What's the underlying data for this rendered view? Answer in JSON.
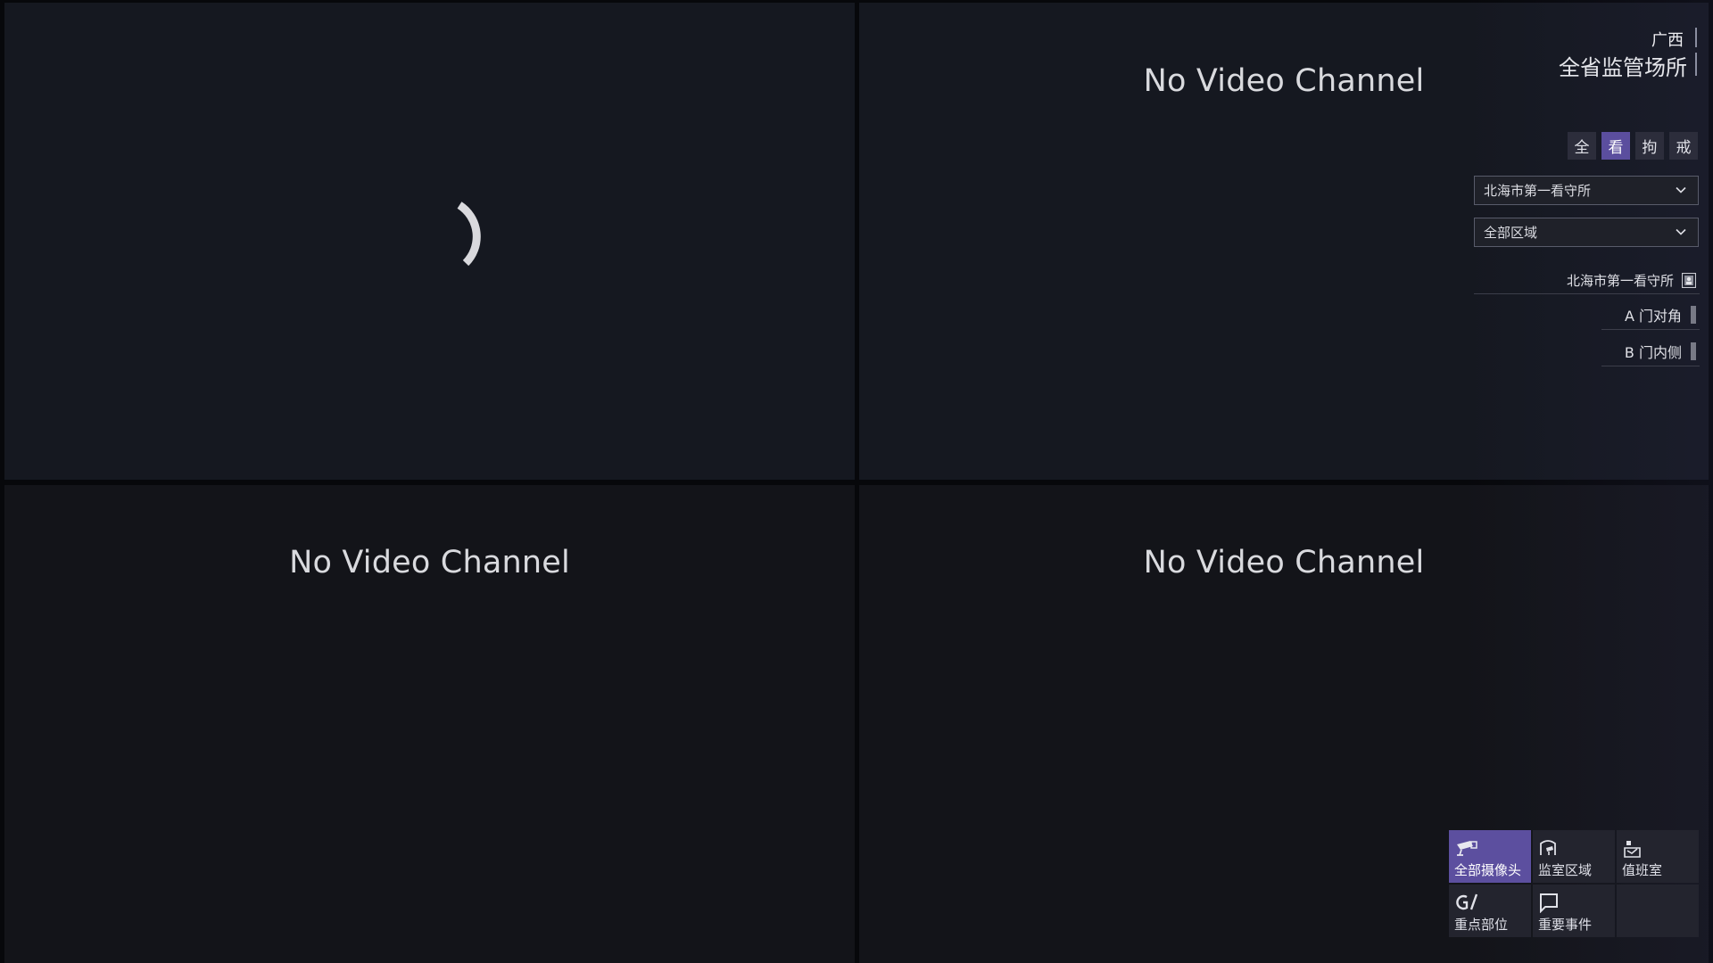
{
  "video_grid": {
    "cells": [
      {
        "status": "loading"
      },
      {
        "message": "No Video Channel"
      },
      {
        "message": "No Video Channel"
      },
      {
        "message": "No Video Channel"
      }
    ]
  },
  "header": {
    "province": "广西",
    "subtitle": "全省监管场所"
  },
  "facility_filters": [
    {
      "label": "全",
      "active": false
    },
    {
      "label": "看",
      "active": true
    },
    {
      "label": "拘",
      "active": false
    },
    {
      "label": "戒",
      "active": false
    }
  ],
  "facility_select": {
    "value": "北海市第一看守所"
  },
  "area_select": {
    "value": "全部区域"
  },
  "tree": {
    "root_label": "北海市第一看守所",
    "items": [
      {
        "label": "A 门对角"
      },
      {
        "label": "B 门内侧"
      }
    ]
  },
  "bottom_nav": [
    {
      "label": "全部摄像头",
      "icon": "camera-icon",
      "active": true
    },
    {
      "label": "监室区域",
      "icon": "cell-area-icon",
      "active": false
    },
    {
      "label": "值班室",
      "icon": "duty-room-icon",
      "active": false
    },
    {
      "label": "重点部位",
      "icon": "key-location-icon",
      "active": false
    },
    {
      "label": "重要事件",
      "icon": "bookmark-icon",
      "active": false
    }
  ],
  "colors": {
    "accent": "#5c4f9f",
    "panel_bg": "#131419",
    "button_bg": "#2c2d3b"
  }
}
